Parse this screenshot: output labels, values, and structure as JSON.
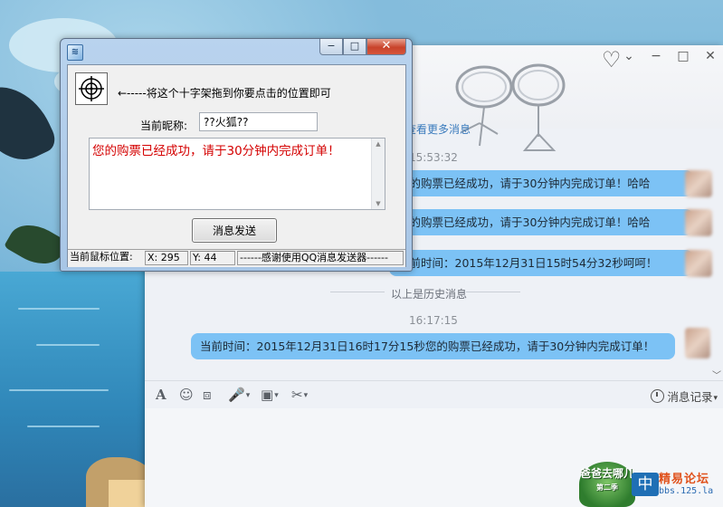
{
  "tool_window": {
    "crosshair_hint": "←-----将这个十字架拖到你要点击的位置即可",
    "nickname_label": "当前昵称:",
    "nickname_value": "??火狐??",
    "message_text": "您的购票已经成功，请于30分钟内完成订单！",
    "send_button": "消息发送",
    "status": {
      "mouse_pos_label": "当前鼠标位置:",
      "x_value": "X: 295",
      "y_value": "Y: 44",
      "thanks": "------感谢使用QQ消息发送器------"
    },
    "buttons": {
      "minimize": "−",
      "maximize": "□",
      "close": "✕"
    }
  },
  "chat_window": {
    "see_more": "查看更多消息",
    "messages": [
      {
        "time": "15:53:32"
      },
      {
        "text": "您的购票已经成功，请于30分钟内完成订单！哈哈"
      },
      {
        "text": "您的购票已经成功，请于30分钟内完成订单！哈哈"
      },
      {
        "text": "当前时间：2015年12月31日15时54分32秒呵呵！"
      }
    ],
    "history_divider": "以上是历史消息",
    "latest_time": "16:17:15",
    "latest_message": "当前时间：2015年12月31日16时17分15秒您的购票已经成功，请于30分钟内完成订单！",
    "record_label": "消息记录",
    "toolbar_icons": [
      "font-icon",
      "emoji-icon",
      "screenshot-icon",
      "voice-icon",
      "image-icon",
      "scissors-icon"
    ]
  },
  "logo": {
    "badge_text": "爸爸去哪儿",
    "badge_sub": "第二季",
    "mid_char": "中",
    "site_name": "精易论坛",
    "site_url": "bbs.125.la"
  }
}
